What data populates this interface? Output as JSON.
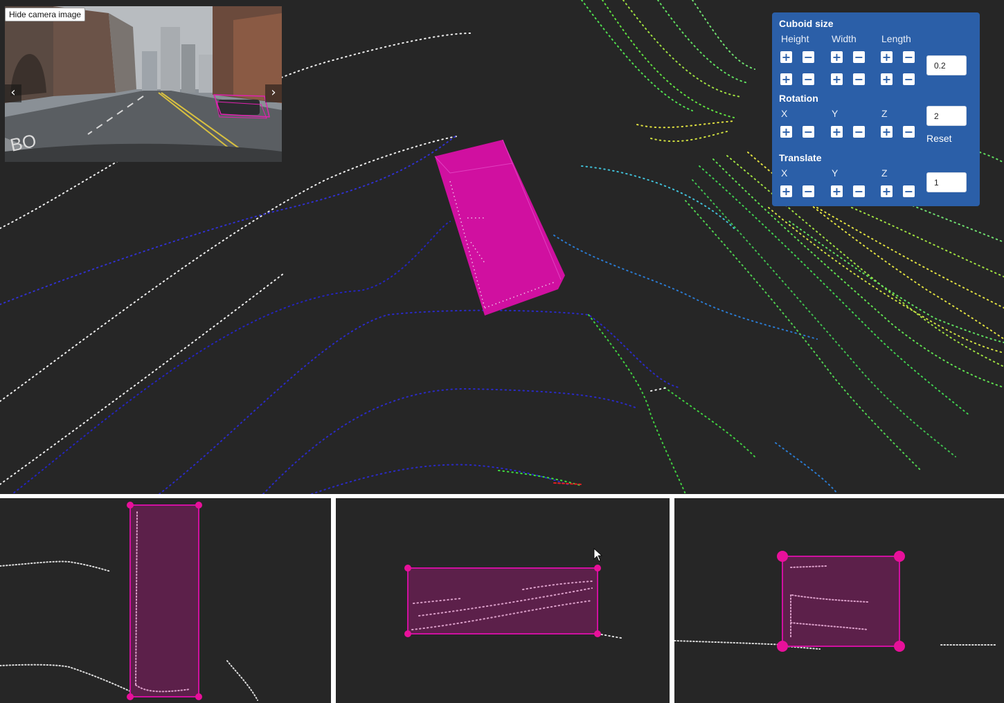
{
  "camera": {
    "hide_label": "Hide camera image",
    "prev_icon": "chevron-left-icon",
    "next_icon": "chevron-right-icon",
    "prev_glyph": "‹",
    "next_glyph": "›"
  },
  "panel": {
    "cuboid_size": {
      "title": "Cuboid size",
      "columns": [
        "Height",
        "Width",
        "Length"
      ],
      "step_value": "0.2"
    },
    "rotation": {
      "title": "Rotation",
      "columns": [
        "X",
        "Y",
        "Z"
      ],
      "step_value": "2",
      "reset_label": "Reset"
    },
    "translate": {
      "title": "Translate",
      "columns": [
        "X",
        "Y",
        "Z"
      ],
      "step_value": "1"
    },
    "plus_glyph": "+",
    "minus_glyph": "−"
  },
  "colors": {
    "panel_bg": "#2b5fa8",
    "cuboid": "#d010a0",
    "background": "#262626",
    "handle": "#e8109a"
  }
}
